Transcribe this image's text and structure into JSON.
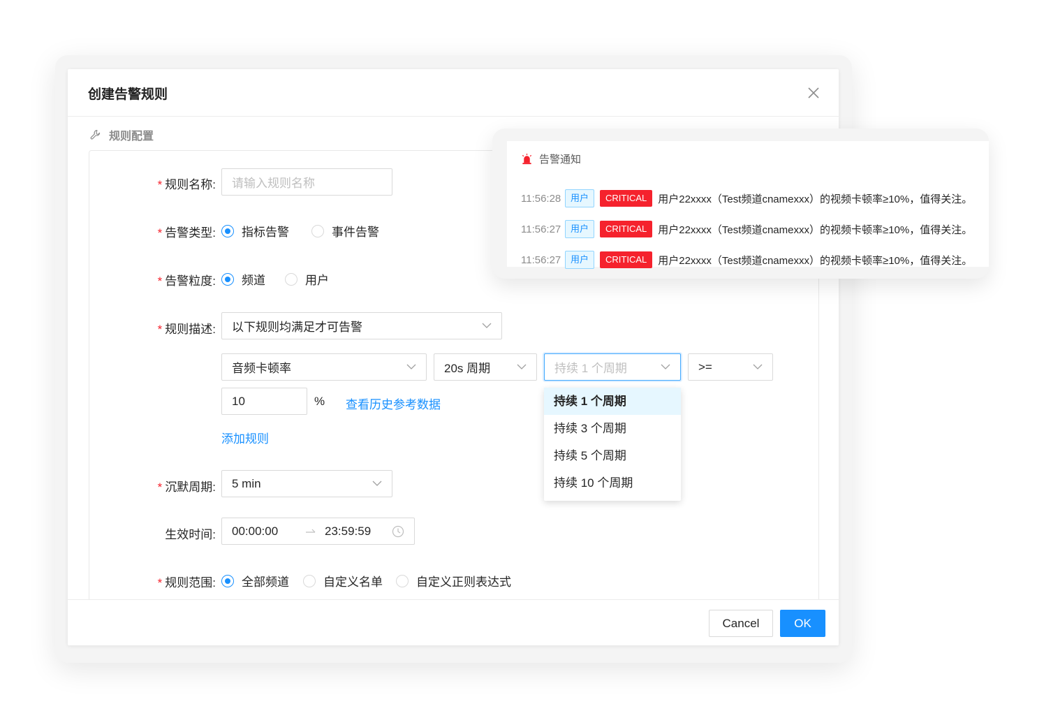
{
  "modal": {
    "title": "创建告警规则",
    "section_title": "规则配置",
    "form": {
      "rule_name": {
        "label": "规则名称",
        "placeholder": "请输入规则名称"
      },
      "alert_type": {
        "label": "告警类型",
        "options": [
          "指标告警",
          "事件告警"
        ],
        "selected": "指标告警"
      },
      "granularity": {
        "label": "告警粒度",
        "options": [
          "频道",
          "用户"
        ],
        "selected": "频道"
      },
      "rule_desc": {
        "label": "规则描述",
        "value": "以下规则均满足才可告警"
      },
      "condition": {
        "metric": "音频卡顿率",
        "period": "20s 周期",
        "duration_placeholder": "持续 1 个周期",
        "operator": ">=",
        "threshold": "10",
        "unit": "%",
        "history_link": "查看历史参考数据",
        "duration_options": [
          "持续 1 个周期",
          "持续 3 个周期",
          "持续 5 个周期",
          "持续 10 个周期"
        ],
        "duration_selected": "持续 1 个周期"
      },
      "add_rule": "添加规则",
      "silence": {
        "label": "沉默周期",
        "value": "5 min"
      },
      "effective_time": {
        "label": "生效时间",
        "start": "00:00:00",
        "end": "23:59:59"
      },
      "scope": {
        "label": "规则范围",
        "options": [
          "全部频道",
          "自定义名单",
          "自定义正则表达式"
        ],
        "selected": "全部频道"
      }
    },
    "footer": {
      "cancel": "Cancel",
      "ok": "OK"
    }
  },
  "notification": {
    "title": "告警通知",
    "items": [
      {
        "time": "11:56:28",
        "tag": "用户",
        "level": "CRITICAL",
        "message": "用户22xxxx（Test频道cnamexxx）的视频卡顿率≥10%，值得关注。"
      },
      {
        "time": "11:56:27",
        "tag": "用户",
        "level": "CRITICAL",
        "message": "用户22xxxx（Test频道cnamexxx）的视频卡顿率≥10%，值得关注。"
      },
      {
        "time": "11:56:27",
        "tag": "用户",
        "level": "CRITICAL",
        "message": "用户22xxxx（Test频道cnamexxx）的视频卡顿率≥10%，值得关注。"
      }
    ]
  },
  "colors": {
    "primary": "#1890ff",
    "critical": "#f5222d",
    "required": "#f5222d"
  },
  "icons": {
    "close": "close-icon",
    "section": "wrench-icon",
    "alarm": "alarm-icon",
    "chevron": "chevron-down-icon",
    "clock": "clock-icon",
    "arrow": "arrow-right-icon"
  }
}
